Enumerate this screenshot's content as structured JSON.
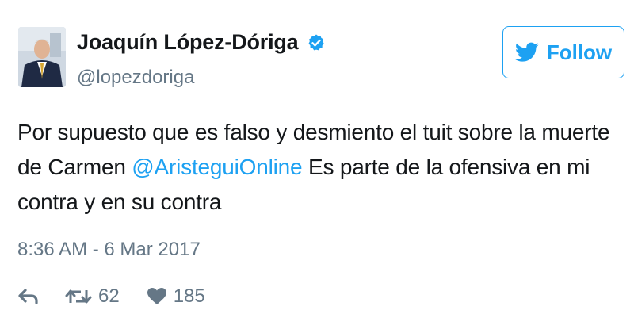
{
  "user": {
    "display_name": "Joaquín López-Dóriga",
    "handle": "@lopezdoriga",
    "verified": true
  },
  "follow_button": {
    "label": "Follow",
    "color": "#1da1f2"
  },
  "tweet": {
    "text_before": "Por supuesto que es falso y desmiento el tuit sobre la muerte de Carmen ",
    "mention": "@AristeguiOnline",
    "text_after": " Es parte de la ofensiva en mi contra y en su contra",
    "timestamp": "8:36 AM - 6 Mar 2017"
  },
  "actions": {
    "retweets": "62",
    "likes": "185"
  },
  "colors": {
    "accent": "#1da1f2",
    "secondary_text": "#657786",
    "primary_text": "#14171a"
  }
}
